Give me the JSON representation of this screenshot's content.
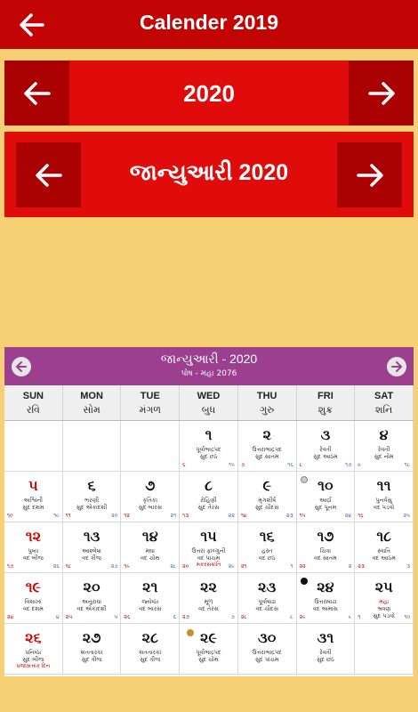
{
  "appbar": {
    "title": "Calender 2019"
  },
  "year_bar": {
    "label": "2020"
  },
  "month_bar": {
    "label": "જાન્યુઆરી 2020"
  },
  "calendar": {
    "month_title": "જાન્યુઆરી - 2020",
    "sub_title": "પોષ - મહા 2076",
    "weekdays": [
      {
        "en": "SUN",
        "gu": "રવિ"
      },
      {
        "en": "MON",
        "gu": "સોમ"
      },
      {
        "en": "TUE",
        "gu": "મંગળ"
      },
      {
        "en": "WED",
        "gu": "બુધ"
      },
      {
        "en": "THU",
        "gu": "ગુરુ"
      },
      {
        "en": "FRI",
        "gu": "શુક્ર"
      },
      {
        "en": "SAT",
        "gu": "શનિ"
      }
    ],
    "cells": [
      {},
      {},
      {},
      {
        "g": "૧",
        "t1": "પૂર્વાભાદ્રપદ",
        "t2": "સુદ છઠ",
        "bl": "૬",
        "br": "૧૫"
      },
      {
        "g": "૨",
        "t1": "ઉત્તરાભાદ્રપદ",
        "t2": "સુદ સાતમ",
        "bl": "૭",
        "br": "૧૬"
      },
      {
        "g": "૩",
        "t1": "રેવતી",
        "t2": "સુદ આઠમ",
        "bl": "૮",
        "br": "૧૭"
      },
      {
        "g": "૪",
        "t1": "રેવતી",
        "t2": "સુદ નોમ",
        "bl": "૯",
        "br": "૧૮"
      },
      {
        "g": "૫",
        "t1": "અશ્વિની",
        "t2": "સુદ દશમ",
        "bl": "૧૦",
        "br": "૧૯",
        "sun": true
      },
      {
        "g": "૬",
        "t1": "ભરણી",
        "t2": "સુદ એકાદશી",
        "bl": "૧૧",
        "br": "૨૦"
      },
      {
        "g": "૭",
        "t1": "કૃતિકા",
        "t2": "સુદ બારસ",
        "bl": "૧૨",
        "br": "૨૧"
      },
      {
        "g": "૮",
        "t1": "રોહિણી",
        "t2": "સુદ તેરસ",
        "bl": "૧૩",
        "br": "૨૨"
      },
      {
        "g": "૯",
        "t1": "મૃગશીર્ષ",
        "t2": "સુદ ચૌદસ",
        "bl": "૧૪",
        "br": "૨૩"
      },
      {
        "g": "૧૦",
        "t1": "આર્દ્રા",
        "t2": "સુદ પૂનમ",
        "bl": "૧૫",
        "br": "૨૪",
        "moon": "full"
      },
      {
        "g": "૧૧",
        "t1": "પુનર્વસુ",
        "t2": "વદ પડવો",
        "bl": "૧૬",
        "br": "૨૫"
      },
      {
        "g": "૧૨",
        "t1": "પુષ્ય",
        "t2": "વદ બીજ",
        "bl": "૧૭",
        "br": "૨૬",
        "sun": true
      },
      {
        "g": "૧૩",
        "t1": "આશ્લેષા",
        "t2": "વદ ત્રીજ",
        "bl": "૧૮",
        "br": "૨૭"
      },
      {
        "g": "૧૪",
        "t1": "મઘા",
        "t2": "વદ ચોથ",
        "bl": "૧૯",
        "br": "૨૮"
      },
      {
        "g": "૧૫",
        "t1": "ઉત્તરા ફાલ્ગુની",
        "t2": "વદ પાંચમ",
        "bl": "૨૦",
        "br": "૨૯",
        "extra": "મકરસંક્રાંતિ"
      },
      {
        "g": "૧૬",
        "t1": "હસ્ત",
        "t2": "વદ છઠ",
        "bl": "૨૧",
        "br": "૧"
      },
      {
        "g": "૧૭",
        "t1": "ચિત્રા",
        "t2": "વદ સાતમ",
        "bl": "૨૨",
        "br": "૨"
      },
      {
        "g": "૧૮",
        "t1": "સ્વાતિ",
        "t2": "વદ આઠમ",
        "bl": "૨૩",
        "br": "૩"
      },
      {
        "g": "૧૯",
        "t1": "વિશાખા",
        "t2": "વદ દશમ",
        "bl": "૨૪",
        "br": "૪",
        "sun": true
      },
      {
        "g": "૨૦",
        "t1": "અનુરાધા",
        "t2": "વદ એકાદશી",
        "bl": "૨૫",
        "br": "૫"
      },
      {
        "g": "૨૧",
        "t1": "જ્યેષ્ઠા",
        "t2": "વદ બારસ",
        "bl": "૨૬",
        "br": "૬"
      },
      {
        "g": "૨૨",
        "t1": "મૂળ",
        "t2": "વદ તેરસ",
        "bl": "૨૭",
        "br": "૭"
      },
      {
        "g": "૨૩",
        "t1": "પૂર્વાષાઢા",
        "t2": "વદ ચૌદસ",
        "bl": "૨૮",
        "br": "૮"
      },
      {
        "g": "૨૪",
        "t1": "ઉત્તરાષાઢા",
        "t2": "વદ અમાસ",
        "bl": "૨૯",
        "br": "૯",
        "moon": "new"
      },
      {
        "g": "૨૫",
        "t1": "મહા",
        "t1red": true,
        "t2": "શ્રવણ",
        "t3": "સુદ પડવો",
        "bl": "૧",
        "br": "૧૦"
      },
      {
        "g": "૨૬",
        "t1": "ધનિષ્ઠા",
        "t2": "સુદ બીજ",
        "bl": "",
        "br": "",
        "sun": true,
        "extra": "પ્રજાસત્તાક દિન"
      },
      {
        "g": "૨૭",
        "t1": "શતતારકા",
        "t2": "સુદ ત્રીજ",
        "bl": "",
        "br": ""
      },
      {
        "g": "૨૮",
        "t1": "શતતારકા",
        "t2": "સુદ ત્રીજ",
        "bl": "",
        "br": ""
      },
      {
        "g": "૨૯",
        "t1": "પૂર્વાભાદ્રપદ",
        "t2": "સુદ ચોથ",
        "bl": "",
        "br": "",
        "deco": true
      },
      {
        "g": "૩૦",
        "t1": "ઉત્તરાભાદ્રપદ",
        "t2": "સુદ પાંચમ",
        "bl": "",
        "br": ""
      },
      {
        "g": "૩૧",
        "t1": "રેવતી",
        "t2": "સુદ છઠ",
        "bl": "",
        "br": ""
      },
      {}
    ]
  }
}
